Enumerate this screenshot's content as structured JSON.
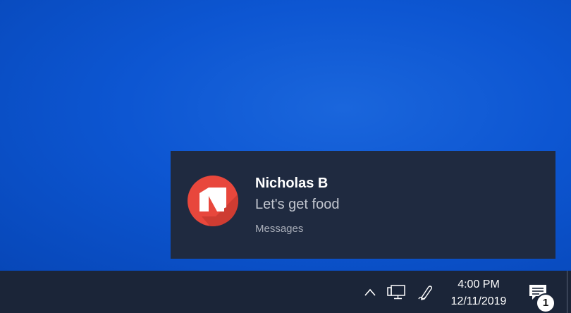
{
  "notification": {
    "sender": "Nicholas B",
    "message": "Let's get food",
    "app": "Messages",
    "avatar_icon": "app-n-logo-icon",
    "avatar_color": "#e8473c"
  },
  "taskbar": {
    "tray_icons": [
      "chevron-up-icon",
      "network-icon",
      "pen-workspace-icon"
    ],
    "time": "4:00 PM",
    "date": "12/11/2019",
    "action_center_icon": "action-center-icon",
    "notification_count": "1"
  },
  "colors": {
    "desktop": "#0d56d2",
    "toast_background": "#1f2a40",
    "taskbar_background": "#1b2538"
  }
}
